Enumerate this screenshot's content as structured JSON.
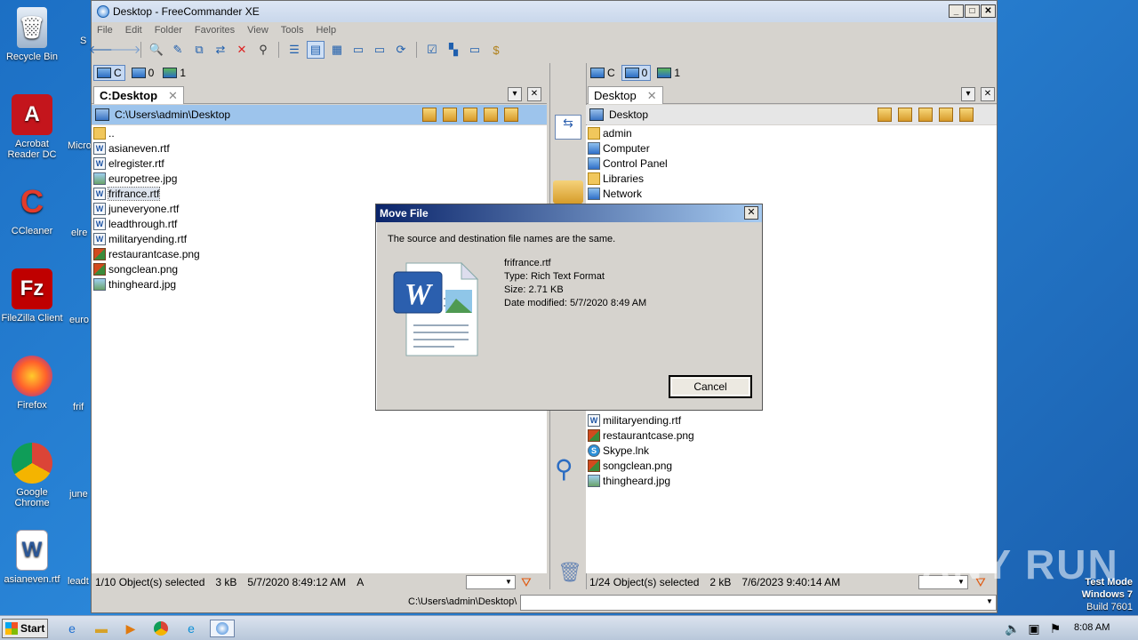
{
  "desktop": {
    "icons": [
      {
        "label": "Recycle Bin"
      },
      {
        "label": "Acrobat Reader DC"
      },
      {
        "label": "CCleaner"
      },
      {
        "label": "FileZilla Client"
      },
      {
        "label": "Firefox"
      },
      {
        "label": "Google Chrome"
      },
      {
        "label": "asianeven.rtf"
      }
    ],
    "clipped_labels": [
      "S",
      "Micro",
      "elre",
      "euro",
      "frif",
      "june",
      "leadt"
    ]
  },
  "window": {
    "title": "Desktop - FreeCommander XE",
    "menu": [
      "File",
      "Edit",
      "Folder",
      "Favorites",
      "View",
      "Tools",
      "Help"
    ]
  },
  "left_panel": {
    "drives": [
      {
        "label": "C"
      },
      {
        "label": "0"
      },
      {
        "label": "1"
      }
    ],
    "tab": "C:Desktop",
    "path": "C:\\Users\\admin\\Desktop",
    "files": [
      {
        "name": "..",
        "icon": "folder-up-icon"
      },
      {
        "name": "asianeven.rtf",
        "icon": "rtf-icon"
      },
      {
        "name": "elregister.rtf",
        "icon": "rtf-icon"
      },
      {
        "name": "europetree.jpg",
        "icon": "jpg-icon"
      },
      {
        "name": "frifrance.rtf",
        "icon": "rtf-icon"
      },
      {
        "name": "juneveryone.rtf",
        "icon": "rtf-icon"
      },
      {
        "name": "leadthrough.rtf",
        "icon": "rtf-icon"
      },
      {
        "name": "militaryending.rtf",
        "icon": "rtf-icon"
      },
      {
        "name": "restaurantcase.png",
        "icon": "png-icon"
      },
      {
        "name": "songclean.png",
        "icon": "png-icon"
      },
      {
        "name": "thingheard.jpg",
        "icon": "jpg-icon"
      }
    ],
    "status": {
      "selected": "1/10 Object(s) selected",
      "size": "3 kB",
      "date": "5/7/2020 8:49:12 AM",
      "attr": "A"
    }
  },
  "right_panel": {
    "drives": [
      {
        "label": "C"
      },
      {
        "label": "0"
      },
      {
        "label": "1"
      }
    ],
    "tab": "Desktop",
    "path": "Desktop",
    "files_top": [
      {
        "name": "admin",
        "icon": "user-folder-icon"
      },
      {
        "name": "Computer",
        "icon": "computer-icon"
      },
      {
        "name": "Control Panel",
        "icon": "control-panel-icon"
      },
      {
        "name": "Libraries",
        "icon": "libraries-icon"
      },
      {
        "name": "Network",
        "icon": "network-icon"
      }
    ],
    "files_bottom": [
      {
        "name": "militaryending.rtf",
        "icon": "rtf-icon"
      },
      {
        "name": "restaurantcase.png",
        "icon": "png-icon"
      },
      {
        "name": "Skype.lnk",
        "icon": "skype-icon"
      },
      {
        "name": "songclean.png",
        "icon": "png-icon"
      },
      {
        "name": "thingheard.jpg",
        "icon": "jpg-icon"
      }
    ],
    "status": {
      "selected": "1/24 Object(s) selected",
      "size": "2 kB",
      "date": "7/6/2023 9:40:14 AM"
    }
  },
  "bottom_path": "C:\\Users\\admin\\Desktop\\",
  "dialog": {
    "title": "Move File",
    "message": "The source and destination file names are the same.",
    "filename": "frifrance.rtf",
    "type": "Type: Rich Text Format",
    "size": "Size: 2.71 KB",
    "modified": "Date modified: 5/7/2020 8:49 AM",
    "cancel": "Cancel"
  },
  "taskbar": {
    "start": "Start",
    "clock": "8:08 AM"
  },
  "watermark": "ANY RUN",
  "win_info": {
    "line1": "Test Mode",
    "line2": "Windows 7",
    "line3": "Build 7601"
  }
}
